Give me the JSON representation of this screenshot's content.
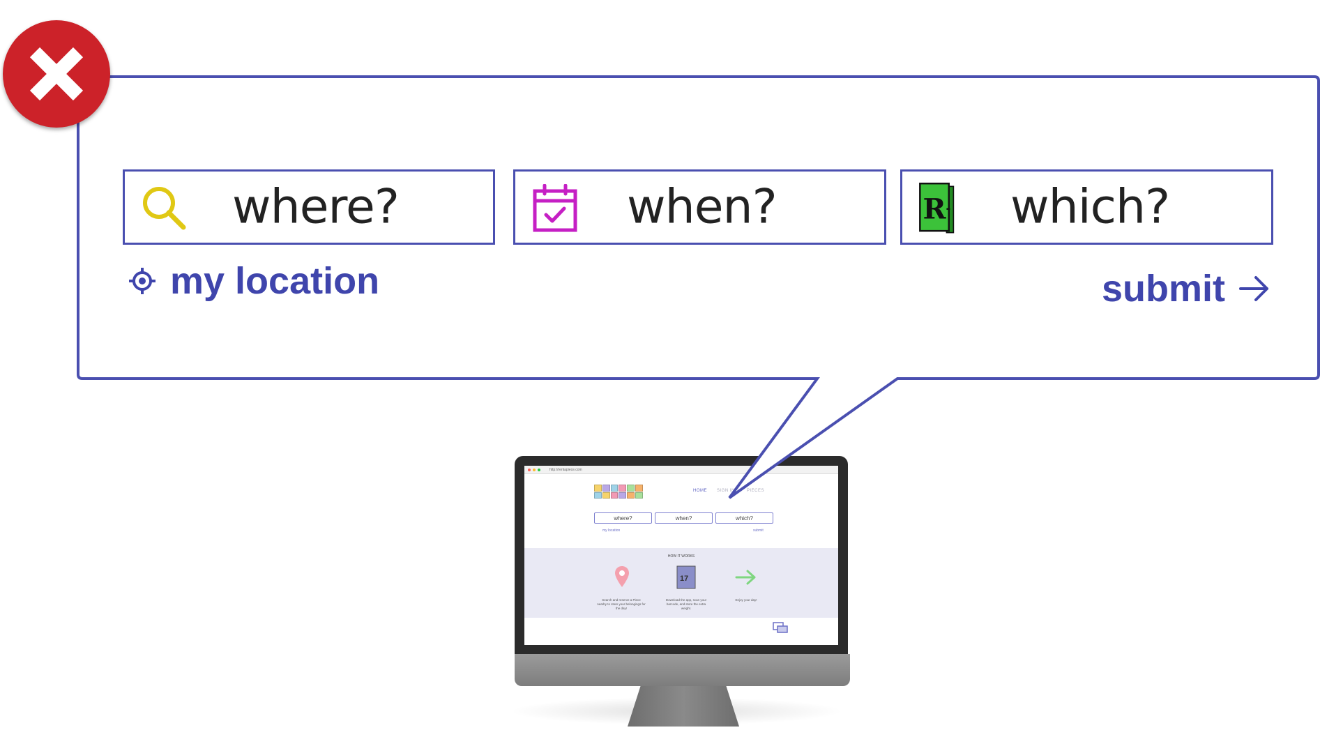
{
  "callout": {
    "fields": [
      {
        "label": "where?",
        "icon": "search-icon"
      },
      {
        "label": "when?",
        "icon": "calendar-check-icon"
      },
      {
        "label": "which?",
        "icon": "book-icon",
        "book_letter": "R"
      }
    ],
    "my_location_label": "my location",
    "submit_label": "submit"
  },
  "error_badge": {
    "icon": "close-icon",
    "color": "#cc2229"
  },
  "colors": {
    "accent": "#3f45ac",
    "border": "#4a4fb0",
    "search_icon": "#e0c814",
    "calendar_icon": "#c51fc4",
    "book_cover": "#3cc23a"
  },
  "monitor": {
    "url": "http://rentapiece.com",
    "nav": {
      "home": "HOME",
      "sign_in": "SIGN IN",
      "pieces": "PIECES"
    },
    "fields": [
      "where?",
      "when?",
      "which?"
    ],
    "my_location": "my location",
    "submit": "submit",
    "how_it_works": {
      "title": "HOW IT WORKS",
      "steps": [
        "Search and reserve a Piece nearby to store your belongings for the day!",
        "Download the app, scan your barcode, and store the extra weight.",
        "Enjoy your day!"
      ]
    }
  }
}
